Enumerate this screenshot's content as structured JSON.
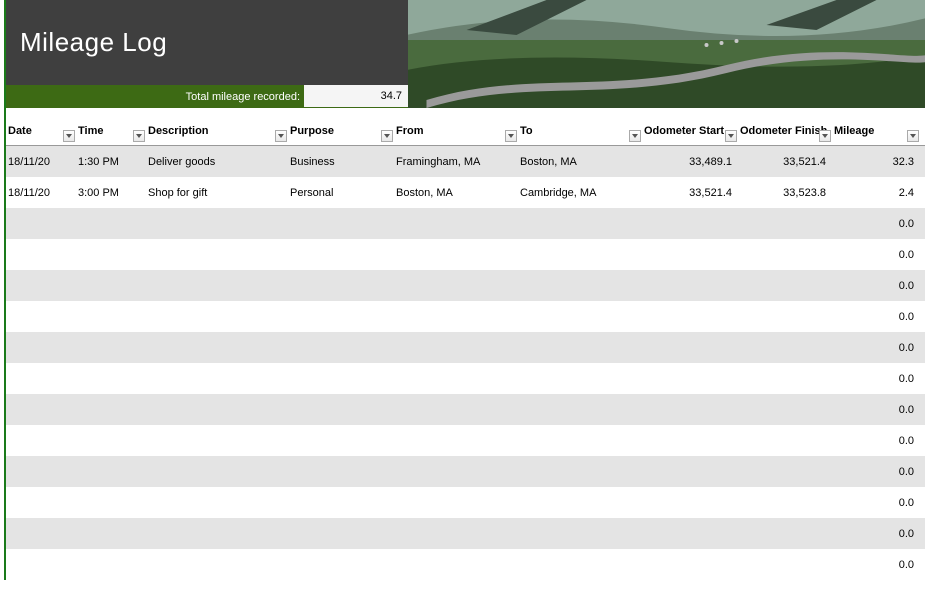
{
  "header": {
    "title": "Mileage Log",
    "total_label": "Total mileage recorded:",
    "total_value": "34.7"
  },
  "columns": {
    "date": "Date",
    "time": "Time",
    "description": "Description",
    "purpose": "Purpose",
    "from": "From",
    "to": "To",
    "odometer_start": "Odometer Start",
    "odometer_finish": "Odometer Finish",
    "mileage": "Mileage"
  },
  "rows": [
    {
      "date": "18/11/20",
      "time": "1:30 PM",
      "description": "Deliver goods",
      "purpose": "Business",
      "from": "Framingham, MA",
      "to": "Boston, MA",
      "odometer_start": "33,489.1",
      "odometer_finish": "33,521.4",
      "mileage": "32.3"
    },
    {
      "date": "18/11/20",
      "time": "3:00 PM",
      "description": "Shop for gift",
      "purpose": "Personal",
      "from": "Boston, MA",
      "to": "Cambridge, MA",
      "odometer_start": "33,521.4",
      "odometer_finish": "33,523.8",
      "mileage": "2.4"
    },
    {
      "date": "",
      "time": "",
      "description": "",
      "purpose": "",
      "from": "",
      "to": "",
      "odometer_start": "",
      "odometer_finish": "",
      "mileage": "0.0"
    },
    {
      "date": "",
      "time": "",
      "description": "",
      "purpose": "",
      "from": "",
      "to": "",
      "odometer_start": "",
      "odometer_finish": "",
      "mileage": "0.0"
    },
    {
      "date": "",
      "time": "",
      "description": "",
      "purpose": "",
      "from": "",
      "to": "",
      "odometer_start": "",
      "odometer_finish": "",
      "mileage": "0.0"
    },
    {
      "date": "",
      "time": "",
      "description": "",
      "purpose": "",
      "from": "",
      "to": "",
      "odometer_start": "",
      "odometer_finish": "",
      "mileage": "0.0"
    },
    {
      "date": "",
      "time": "",
      "description": "",
      "purpose": "",
      "from": "",
      "to": "",
      "odometer_start": "",
      "odometer_finish": "",
      "mileage": "0.0"
    },
    {
      "date": "",
      "time": "",
      "description": "",
      "purpose": "",
      "from": "",
      "to": "",
      "odometer_start": "",
      "odometer_finish": "",
      "mileage": "0.0"
    },
    {
      "date": "",
      "time": "",
      "description": "",
      "purpose": "",
      "from": "",
      "to": "",
      "odometer_start": "",
      "odometer_finish": "",
      "mileage": "0.0"
    },
    {
      "date": "",
      "time": "",
      "description": "",
      "purpose": "",
      "from": "",
      "to": "",
      "odometer_start": "",
      "odometer_finish": "",
      "mileage": "0.0"
    },
    {
      "date": "",
      "time": "",
      "description": "",
      "purpose": "",
      "from": "",
      "to": "",
      "odometer_start": "",
      "odometer_finish": "",
      "mileage": "0.0"
    },
    {
      "date": "",
      "time": "",
      "description": "",
      "purpose": "",
      "from": "",
      "to": "",
      "odometer_start": "",
      "odometer_finish": "",
      "mileage": "0.0"
    },
    {
      "date": "",
      "time": "",
      "description": "",
      "purpose": "",
      "from": "",
      "to": "",
      "odometer_start": "",
      "odometer_finish": "",
      "mileage": "0.0"
    },
    {
      "date": "",
      "time": "",
      "description": "",
      "purpose": "",
      "from": "",
      "to": "",
      "odometer_start": "",
      "odometer_finish": "",
      "mileage": "0.0"
    }
  ]
}
